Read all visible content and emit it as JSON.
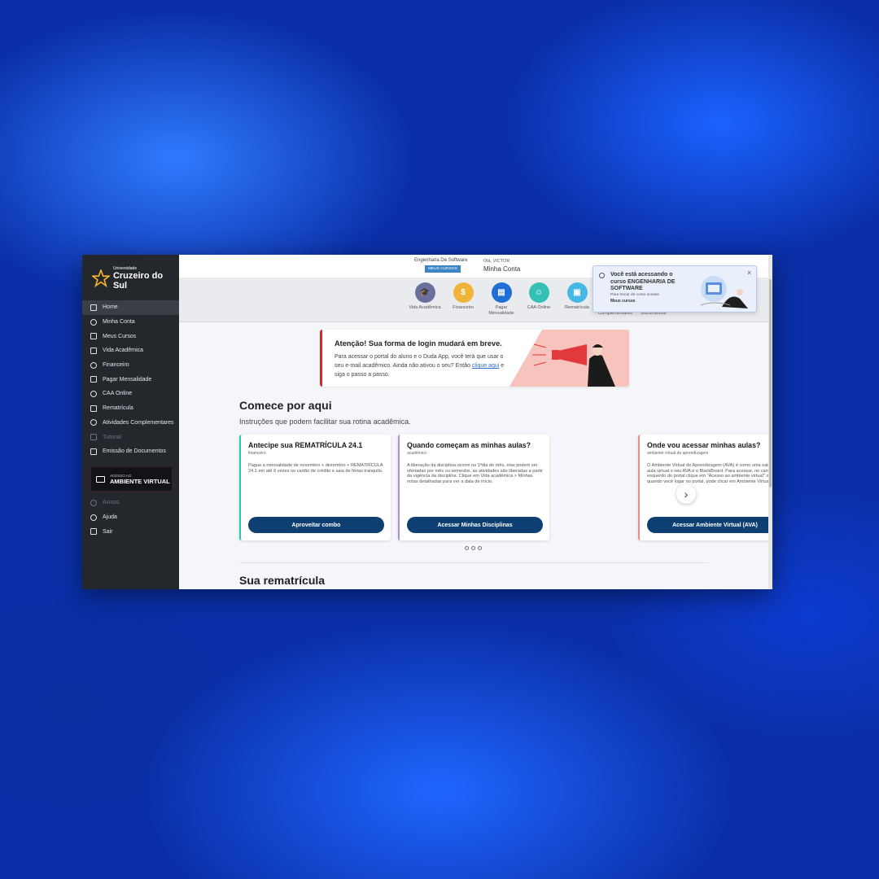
{
  "sidebar": {
    "logo_small": "Universidade",
    "logo_big": "Cruzeiro do Sul",
    "items": [
      {
        "label": "Home",
        "icon": "home-icon"
      },
      {
        "label": "Minha Conta",
        "icon": "user-icon"
      },
      {
        "label": "Meus Cursos",
        "icon": "courses-icon"
      },
      {
        "label": "Vida Acadêmica",
        "icon": "graduation-cap-icon"
      },
      {
        "label": "Financeiro",
        "icon": "dollar-icon"
      },
      {
        "label": "Pagar Mensalidade",
        "icon": "payment-icon"
      },
      {
        "label": "CAA Online",
        "icon": "headset-icon"
      },
      {
        "label": "Rematrícula",
        "icon": "enroll-icon"
      },
      {
        "label": "Atividades Complementares",
        "icon": "check-icon"
      },
      {
        "label": "Tutorial",
        "icon": "tutorial-icon"
      },
      {
        "label": "Emissão de Documentos",
        "icon": "document-icon"
      }
    ],
    "ava_small": "ACESSO AO",
    "ava_big": "AMBIENTE VIRTUAL",
    "bottom_items": [
      {
        "label": "Avisos",
        "icon": "bell-icon"
      },
      {
        "label": "Ajuda",
        "icon": "help-icon"
      },
      {
        "label": "Sair",
        "icon": "logout-icon"
      }
    ]
  },
  "header": {
    "course_name": "Engenharia De Software",
    "course_badge": "MEUS CURSOS",
    "greeting": "Olá, VICTOR",
    "account_link": "Minha Conta"
  },
  "iconbar": [
    {
      "label": "Vida Acadêmica",
      "color": "#6a6f9e",
      "glyph": "🎓"
    },
    {
      "label": "Financeiro",
      "color": "#f0b43a",
      "glyph": "$"
    },
    {
      "label": "Pagar Mensalidade",
      "color": "#1f6fd6",
      "glyph": "▤"
    },
    {
      "label": "CAA Online",
      "color": "#35c0b5",
      "glyph": "☺"
    },
    {
      "label": "Rematrícula",
      "color": "#47b7e6",
      "glyph": "▣"
    },
    {
      "label": "Atividades Complementares",
      "color": "#ef5fb8",
      "glyph": "✓"
    },
    {
      "label": "Emissão de Documentos",
      "color": "#0f3b6e",
      "glyph": "▦"
    }
  ],
  "notification": {
    "title": "Você está acessando o curso ENGENHARIA DE SOFTWARE",
    "subtitle": "Para trocar de curso acesse",
    "link": "Meus cursos",
    "close": "×"
  },
  "banner": {
    "title": "Atenção! Sua forma de login mudará em breve.",
    "text_before": "Para acessar o portal do aluno e o Duda App, você terá que usar o seu e-mail acadêmico. Ainda não ativou o seu? Então ",
    "link": "clique aqui",
    "text_after": " e siga o passo a passo."
  },
  "section": {
    "title": "Comece por aqui",
    "subtitle": "Instruções que podem facilitar sua rotina acadêmica."
  },
  "cards": [
    {
      "title": "Antecipe sua REMATRÍCULA 24.1",
      "tag": "financeiro",
      "text": "Pague a mensalidade de novembro + dezembro + REMATRÍCULA 24.1 em até 6 vezes no cartão de crédito e saia de férias tranquilo.",
      "button": "Aproveitar combo",
      "accent": "#2fc4b2"
    },
    {
      "title": "Quando começam as minhas aulas?",
      "tag": "acadêmico",
      "text": "A liberação da disciplina ocorre no 1ºdia do mês, elas podem ser ofertadas por mês ou semestre, as atividades são liberadas a partir da vigência da disciplina. Clique em Vida acadêmica > Minhas notas detalhadas para ver a data de início.",
      "button": "Acessar Minhas Disciplinas",
      "accent": "#b58bd6"
    },
    {
      "title": "Onde vou acessar minhas aulas?",
      "tag": "ambiente virtual de aprendizagem",
      "text": "O Ambiente Virtual de Aprendizagem (AVA) é como uma sala de aula virtual o seu AVA é o BlackBoard. Para acessar, no canto esquerdo do portal clique em \"Acesso ao ambiente virtual\" ou quando você logar no portal, pode clicar em Ambiente Virtual.",
      "button": "Acessar Ambiente Virtual (AVA)",
      "accent": "#f08a8a"
    }
  ],
  "section2": {
    "title": "Sua rematrícula"
  }
}
